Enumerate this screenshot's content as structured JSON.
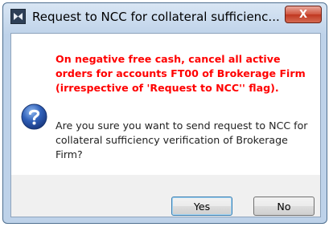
{
  "window": {
    "title": "Request to NCC for collateral sufficienc...",
    "close_label": "X"
  },
  "dialog": {
    "warning_text": "On negative free cash, cancel all active orders for accounts FT00 of Brokerage Firm (irrespective of 'Request to NCC'' flag).",
    "question_text": "Are you sure you want to send request to NCC for collateral sufficiency verification of Brokerage Firm?",
    "icon": "question-icon",
    "accent_color": "#ff0000"
  },
  "buttons": {
    "yes_label": "Yes",
    "no_label": "No"
  }
}
